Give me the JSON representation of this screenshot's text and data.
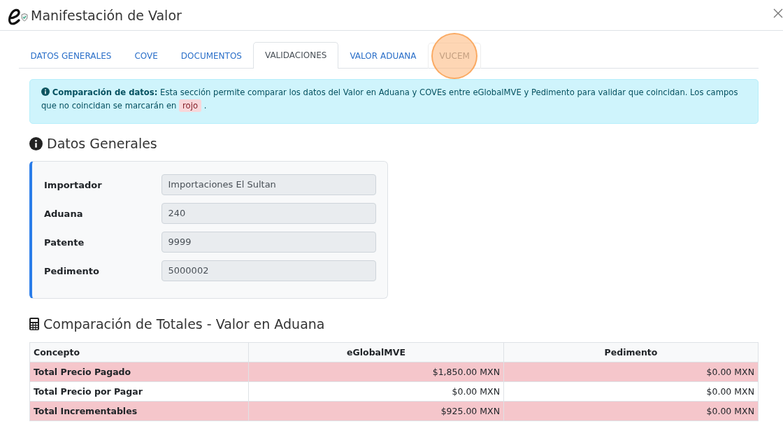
{
  "window": {
    "title": "Manifestación de Valor"
  },
  "tabs": [
    {
      "label": "DATOS GENERALES",
      "selected": false
    },
    {
      "label": "COVE",
      "selected": false
    },
    {
      "label": "DOCUMENTOS",
      "selected": false
    },
    {
      "label": "VALIDACIONES",
      "selected": true
    },
    {
      "label": "VALOR ADUANA",
      "selected": false
    },
    {
      "label": "VUCEM",
      "selected": false,
      "hovered": true
    }
  ],
  "alert": {
    "text": "**Comparación de datos:** Esta sección permite comparar los datos del Valor en Aduana y COVEs entre eGlobalMVE y Pedimento para validar que coincidan. Los campos que no coincidan se marcarán en",
    "tag": "rojo",
    "end": "."
  },
  "general": {
    "title": "Datos Generales",
    "fields": [
      {
        "label": "Importador",
        "value": "Importaciones El Sultan"
      },
      {
        "label": "Aduana",
        "value": "240"
      },
      {
        "label": "Patente",
        "value": "9999"
      },
      {
        "label": "Pedimento",
        "value": "5000002"
      }
    ]
  },
  "totals": {
    "title": "Comparación de Totales - Valor en Aduana",
    "columns": [
      "Concepto",
      "eGlobalMVE",
      "Pedimento"
    ],
    "rows": [
      {
        "cells": [
          "Total Precio Pagado",
          "$1,850.00 MXN",
          "$0.00 MXN"
        ],
        "mismatch": true
      },
      {
        "cells": [
          "Total Precio por Pagar",
          "$0.00 MXN",
          "$0.00 MXN"
        ],
        "mismatch": false
      },
      {
        "cells": [
          "Total Incrementables",
          "$925.00 MXN",
          "$0.00 MXN"
        ],
        "mismatch": true
      }
    ]
  }
}
